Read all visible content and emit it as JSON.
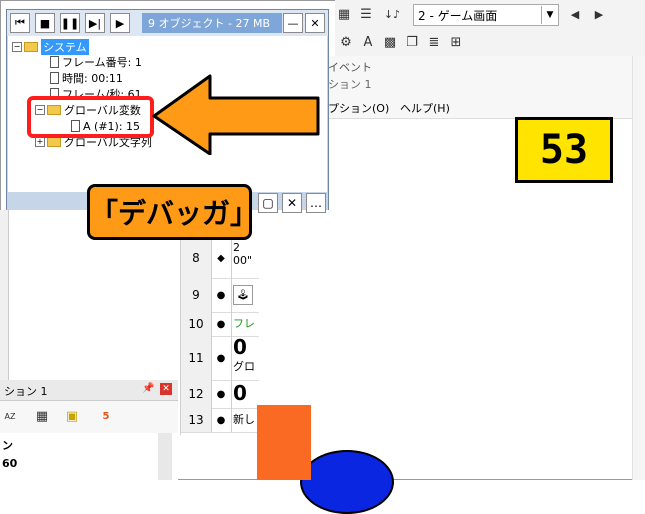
{
  "debugger": {
    "title": "9 オブジェクト - 27 MB",
    "toolbar_icons": [
      "restart-icon",
      "stop-icon",
      "pause-icon",
      "step-icon",
      "play-icon"
    ],
    "tree": [
      {
        "label": "システム",
        "selected": true
      },
      {
        "label": "フレーム番号: 1"
      },
      {
        "label": "時間: 00:11"
      },
      {
        "label": "フレーム/秒: 61"
      },
      {
        "label": "グローバル変数"
      },
      {
        "label": "A (#1): 15"
      },
      {
        "label": "グローバル文字列"
      }
    ]
  },
  "annotation": {
    "callout": "「デバッガ」"
  },
  "toolbar": {
    "scene_select": "2 - ゲーム画面"
  },
  "options_window": {
    "title": "ション 1",
    "tab_event": "イベント",
    "menu_option": "プション(O)",
    "menu_help": "ヘルプ(H)"
  },
  "game": {
    "score": "53"
  },
  "event_rows": [
    {
      "num": "8",
      "text": "00\"",
      "top": "2"
    },
    {
      "num": "9",
      "text": ""
    },
    {
      "num": "10",
      "text": "フレー"
    },
    {
      "num": "11",
      "text": "グロー",
      "top": "0"
    },
    {
      "num": "12",
      "text": "",
      "top": "0"
    },
    {
      "num": "13",
      "text": "新し"
    }
  ],
  "bottom_panel": {
    "title": "ション 1",
    "heading": "ン",
    "value": "60"
  },
  "colors": {
    "accent": "#ff9a16",
    "highlight": "#ff1c1c",
    "score_bg": "#ffe400"
  }
}
